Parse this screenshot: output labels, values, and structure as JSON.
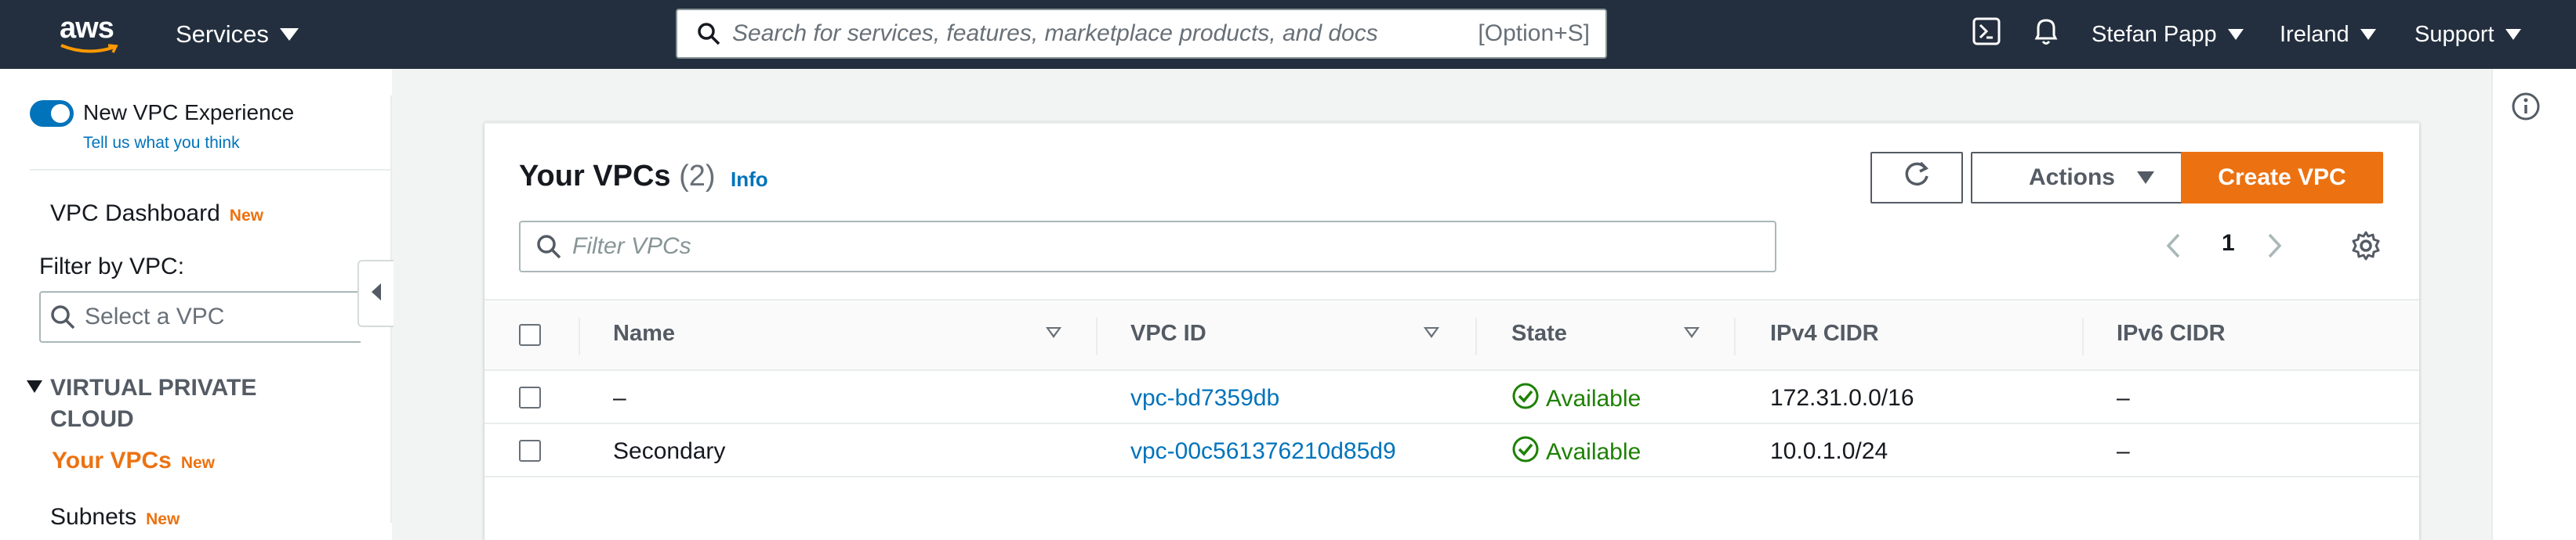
{
  "topnav": {
    "logo_text": "aws",
    "services_label": "Services",
    "search_placeholder": "Search for services, features, marketplace products, and docs",
    "search_shortcut": "[Option+S]",
    "user_label": "Stefan Papp",
    "region_label": "Ireland",
    "support_label": "Support"
  },
  "sidebar": {
    "new_experience_label": "New VPC Experience",
    "feedback_link": "Tell us what you think",
    "dashboard_label": "VPC Dashboard",
    "new_badge": "New",
    "filter_label": "Filter by VPC:",
    "filter_placeholder": "Select a VPC",
    "section_title": "VIRTUAL PRIVATE CLOUD",
    "items": [
      {
        "label": "Your VPCs",
        "badge": "New",
        "active": true
      },
      {
        "label": "Subnets",
        "badge": "New",
        "active": false
      }
    ]
  },
  "main": {
    "title": "Your VPCs",
    "count": "(2)",
    "info_link": "Info",
    "actions_label": "Actions",
    "create_label": "Create VPC",
    "filter_placeholder": "Filter VPCs",
    "current_page": "1",
    "columns": [
      "Name",
      "VPC ID",
      "State",
      "IPv4 CIDR",
      "IPv6 CIDR"
    ],
    "rows": [
      {
        "name": "–",
        "vpc_id": "vpc-bd7359db",
        "state": "Available",
        "ipv4": "172.31.0.0/16",
        "ipv6": "–"
      },
      {
        "name": "Secondary",
        "vpc_id": "vpc-00c561376210d85d9",
        "state": "Available",
        "ipv4": "10.0.1.0/24",
        "ipv6": "–"
      }
    ]
  },
  "colors": {
    "nav_bg": "#232f3e",
    "accent_orange": "#ec7211",
    "link_blue": "#0073bb",
    "status_green": "#1d8102"
  },
  "icons": [
    "search-icon",
    "cloudshell-icon",
    "bell-icon",
    "caret-down-icon",
    "refresh-icon",
    "chevron-left-icon",
    "chevron-right-icon",
    "settings-gear-icon",
    "info-circle-icon",
    "check-circle-icon",
    "collapse-arrow-icon"
  ]
}
